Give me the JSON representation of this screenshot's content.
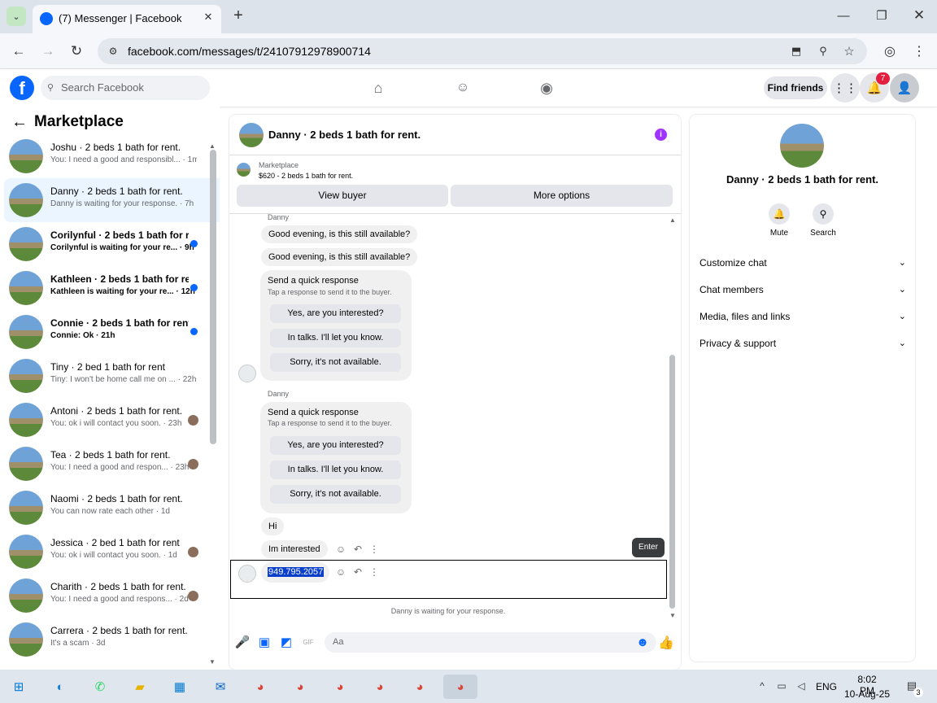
{
  "browser": {
    "tab_title": "(7) Messenger | Facebook",
    "url": "facebook.com/messages/t/24107912978900714"
  },
  "fb": {
    "search_placeholder": "Search Facebook",
    "find_friends": "Find friends",
    "notif_count": "7"
  },
  "sidebar": {
    "title": "Marketplace",
    "items": [
      {
        "name": "Joshu · 2 beds 1 bath for rent.",
        "preview": "You: I need a good and responsibl... · 1m",
        "unread": false
      },
      {
        "name": "Danny · 2 beds 1 bath for rent.",
        "preview": "Danny is waiting for your response. · 7h",
        "unread": false
      },
      {
        "name": "Corilynful · 2 beds 1 bath for re...",
        "preview": "Corilynful is waiting for your re... · 9h",
        "unread": true
      },
      {
        "name": "Kathleen · 2 beds 1 bath for re...",
        "preview": "Kathleen is waiting for your re... · 12h",
        "unread": true
      },
      {
        "name": "Connie · 2 beds 1 bath for rent.",
        "preview": "Connie: Ok · 21h",
        "unread": true
      },
      {
        "name": "Tiny · 2 bed 1 bath for rent",
        "preview": "Tiny: I won't be home call me on ... · 22h",
        "unread": false
      },
      {
        "name": "Antoni · 2 beds 1 bath for rent.",
        "preview": "You: ok i will contact you soon. · 23h",
        "unread": false
      },
      {
        "name": "Tea · 2 beds 1 bath for rent.",
        "preview": "You: I need a good and respon... · 23h",
        "unread": false
      },
      {
        "name": "Naomi · 2 beds 1 bath for rent.",
        "preview": "You can now rate each other · 1d",
        "unread": false
      },
      {
        "name": "Jessica · 2 bed 1 bath for rent",
        "preview": "You: ok i will contact you soon. · 1d",
        "unread": false
      },
      {
        "name": "Charith · 2 beds 1 bath for rent.",
        "preview": "You: I need a good and respons... · 2d",
        "unread": false
      },
      {
        "name": "Carrera · 2 beds 1 bath for rent.",
        "preview": "It's a scam · 3d",
        "unread": false
      }
    ]
  },
  "chat": {
    "title": "Danny · 2 beds 1 bath for rent.",
    "listing_label": "Marketplace",
    "listing_price": "$620 - 2 beds 1 bath for rent.",
    "view_buyer": "View buyer",
    "more_options": "More options",
    "sender": "Danny",
    "msg1": "Good evening, is this still available?",
    "msg2": "Good evening, is this still available?",
    "quick_title": "Send a quick response",
    "quick_sub": "Tap a response to send it to the buyer.",
    "quick_opts": [
      "Yes, are you interested?",
      "In talks. I'll let you know.",
      "Sorry, it's not available."
    ],
    "my1": "Hi",
    "my2": "Im interested",
    "my3": "949.795.2057",
    "tooltip": "Enter",
    "waiting": "Danny is waiting for your response.",
    "compose_placeholder": "Aa"
  },
  "right": {
    "title": "Danny · 2 beds 1 bath for rent.",
    "mute": "Mute",
    "search": "Search",
    "rows": [
      "Customize chat",
      "Chat members",
      "Media, files and links",
      "Privacy & support"
    ]
  },
  "taskbar": {
    "lang": "ENG",
    "time": "8:02 PM",
    "date": "10-Aug-25",
    "notif": "3"
  }
}
